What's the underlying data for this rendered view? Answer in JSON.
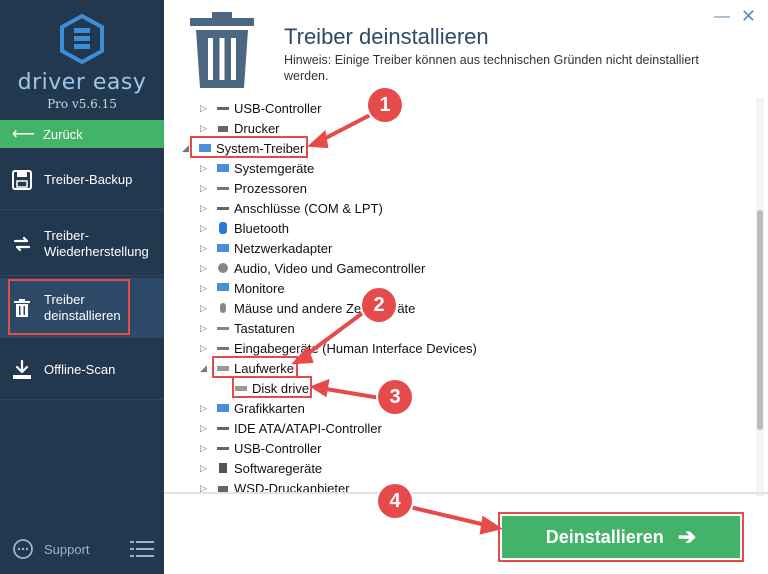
{
  "sidebar": {
    "brand": "driver easy",
    "version": "Pro v5.6.15",
    "back_label": "Zurück",
    "items": [
      {
        "label": "Treiber-Backup",
        "icon": "floppy-icon"
      },
      {
        "label_line1": "Treiber-",
        "label_line2": "Wiederherstellung",
        "icon": "restore-icon"
      },
      {
        "label_line1": "Treiber",
        "label_line2": "deinstallieren",
        "icon": "trash-icon"
      },
      {
        "label": "Offline-Scan",
        "icon": "download-icon"
      }
    ],
    "support_label": "Support"
  },
  "header": {
    "title": "Treiber deinstallieren",
    "hint": "Hinweis: Einige Treiber können aus technischen Gründen nicht deinstalliert werden."
  },
  "window": {
    "minimize": "—",
    "close": "✕"
  },
  "tree": {
    "rows": [
      {
        "label": "USB-Controller"
      },
      {
        "label": "Drucker"
      },
      {
        "label": "System-Treiber"
      },
      {
        "label": "Systemgeräte"
      },
      {
        "label": "Prozessoren"
      },
      {
        "label": "Anschlüsse (COM & LPT)"
      },
      {
        "label": "Bluetooth"
      },
      {
        "label": "Netzwerkadapter"
      },
      {
        "label": "Audio, Video und Gamecontroller"
      },
      {
        "label": "Monitore"
      },
      {
        "label": "Mäuse und andere Zeigegeräte"
      },
      {
        "label": "Tastaturen"
      },
      {
        "label": "Eingabegeräte (Human Interface Devices)"
      },
      {
        "label": "Laufwerke"
      },
      {
        "label": "Disk drive"
      },
      {
        "label": "Grafikkarten"
      },
      {
        "label": "IDE ATA/ATAPI-Controller"
      },
      {
        "label": "USB-Controller"
      },
      {
        "label": "Softwaregeräte"
      },
      {
        "label": "WSD-Druckanbieter"
      }
    ]
  },
  "badges": [
    "1",
    "2",
    "3",
    "4"
  ],
  "action": {
    "uninstall_label": "Deinstallieren"
  },
  "colors": {
    "sidebar": "#22384f",
    "accent_green": "#43b36a",
    "highlight_red": "#e54b4b",
    "title": "#2e4a66"
  }
}
